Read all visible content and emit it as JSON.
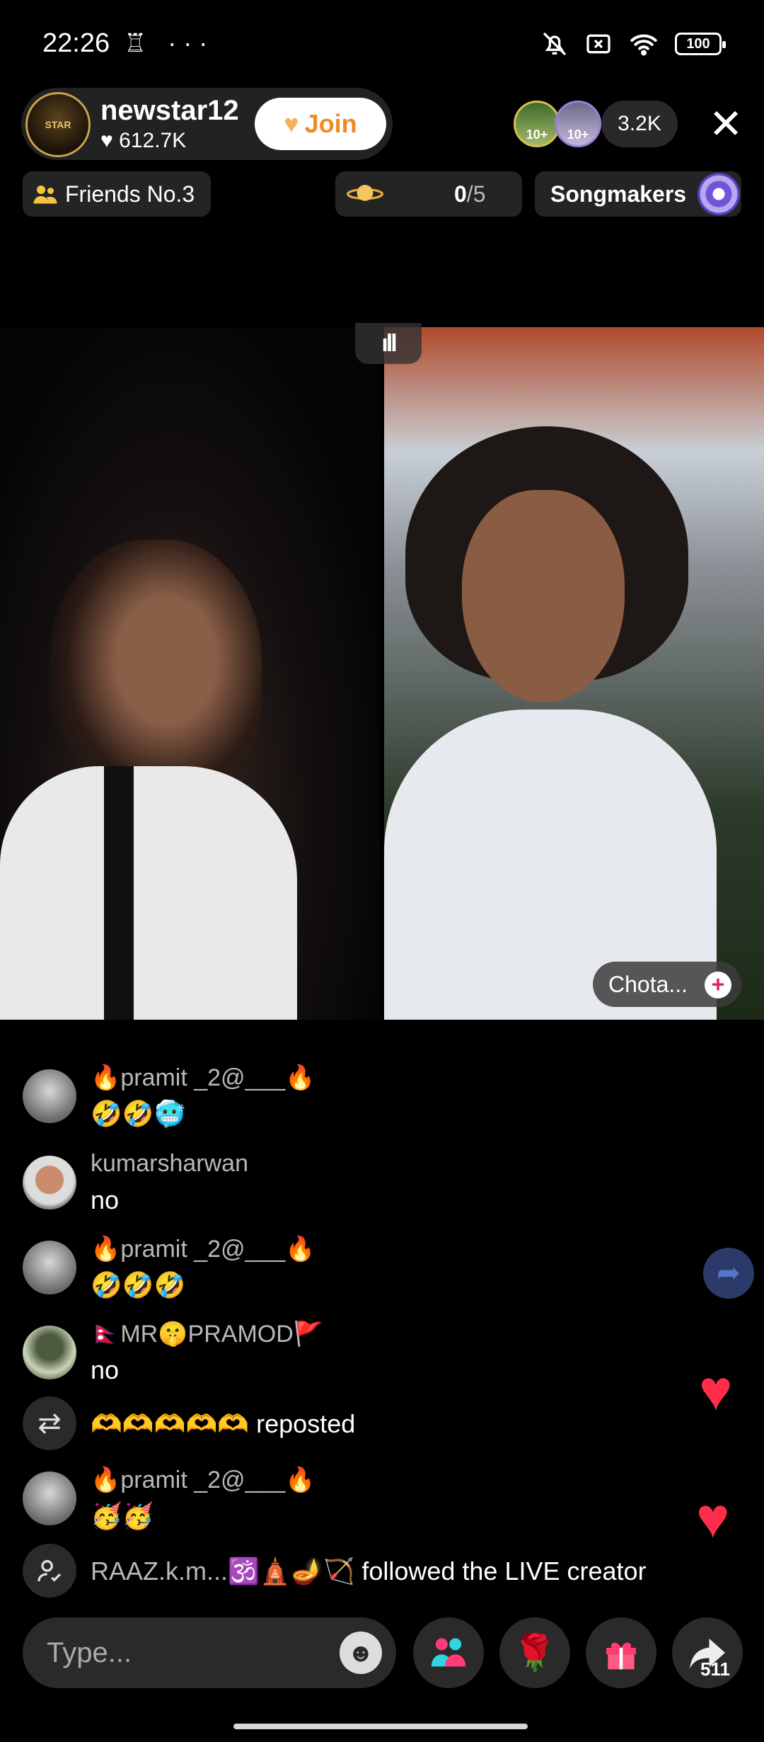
{
  "status_bar": {
    "time": "22:26",
    "left_icons": "♖ ···",
    "battery": "100"
  },
  "host": {
    "name": "newstar12",
    "likes": "612.7K",
    "avatar_text": "STAR",
    "join_label": "Join"
  },
  "viewers": {
    "badge_a": "10+",
    "badge_b": "10+",
    "count": "3.2K"
  },
  "chips": {
    "friends_label": "Friends No.3",
    "goal_num": "0",
    "goal_den": "/5",
    "songs_label": "Songmakers"
  },
  "video": {
    "audio_icon": "ıll",
    "guest_name": "Chota..."
  },
  "chat": [
    {
      "user": "🔥pramit _2@___🔥",
      "text": "🤣🤣🥶"
    },
    {
      "user": "kumarsharwan",
      "text": "no"
    },
    {
      "user": "🔥pramit _2@___🔥",
      "text": "🤣🤣🤣"
    },
    {
      "user": "🇳🇵MR🤫PRAMOD🚩",
      "text": "no"
    },
    {
      "emoji": "🫶🫶🫶🫶🫶",
      "action": "reposted"
    },
    {
      "user": "🔥pramit _2@___🔥",
      "text": "🥳🥳"
    },
    {
      "user": "RAAZ.k.m...🕉️🛕🪔🏹",
      "action": "followed the LIVE creator"
    }
  ],
  "bottom": {
    "placeholder": "Type...",
    "share_count": "511"
  },
  "colors": {
    "accent_heart": "#ff2d4a",
    "join_text": "#f08a24",
    "background": "#000000"
  }
}
